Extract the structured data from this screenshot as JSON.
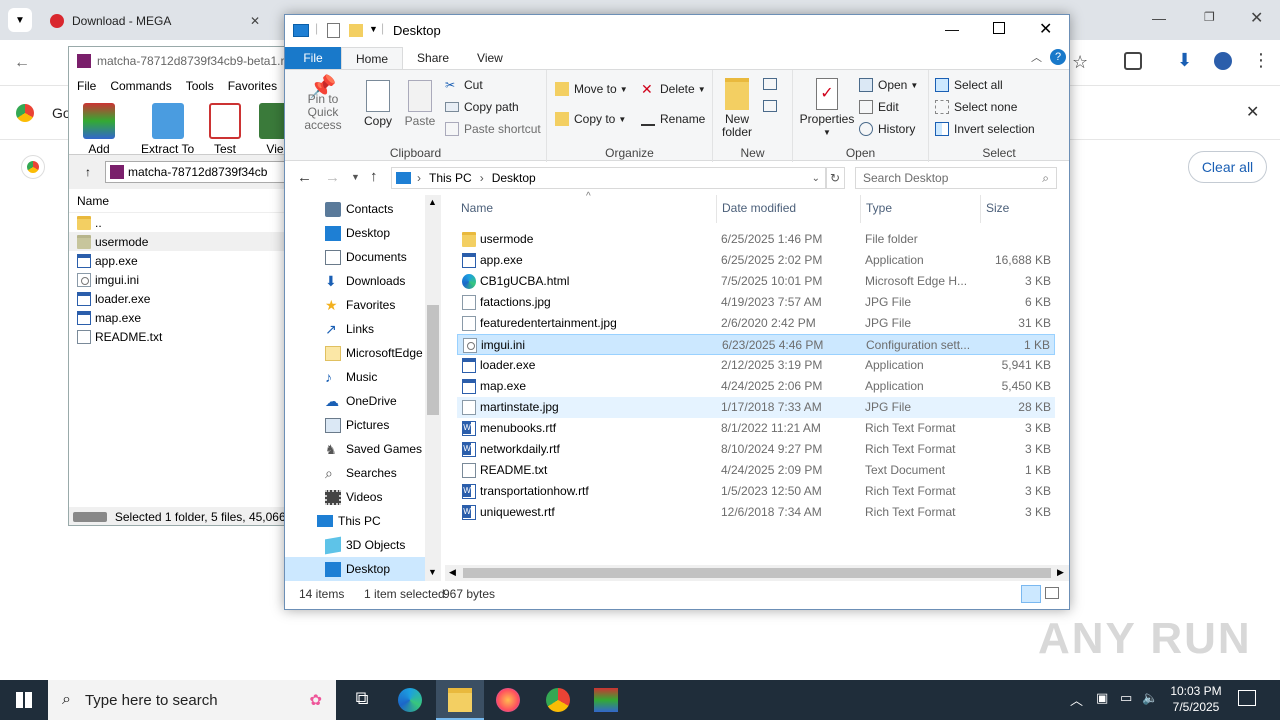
{
  "chrome": {
    "tab1_title": "Download - MEGA",
    "notice_prefix": "Go",
    "clear_all": "Clear all"
  },
  "winrar": {
    "title": "matcha-78712d8739f34cb9-beta1.r",
    "menu": [
      "File",
      "Commands",
      "Tools",
      "Favorites"
    ],
    "toolbar": [
      "Add",
      "Extract To",
      "Test",
      "Vie"
    ],
    "path": "matcha-78712d8739f34cb",
    "column_name": "Name",
    "rows": [
      "..",
      "usermode",
      "app.exe",
      "imgui.ini",
      "loader.exe",
      "map.exe",
      "README.txt"
    ],
    "status": "Selected 1 folder, 5 files, 45,066,"
  },
  "explorer": {
    "title": "Desktop",
    "tabs": [
      "File",
      "Home",
      "Share",
      "View"
    ],
    "clipboard": {
      "pin": "Pin to Quick access",
      "copy": "Copy",
      "paste": "Paste",
      "cut": "Cut",
      "copy_path": "Copy path",
      "paste_shortcut": "Paste shortcut",
      "label": "Clipboard"
    },
    "organize": {
      "move_to": "Move to",
      "copy_to": "Copy to",
      "delete": "Delete",
      "rename": "Rename",
      "label": "Organize"
    },
    "new": {
      "new_folder": "New folder",
      "label": "New"
    },
    "open": {
      "properties": "Properties",
      "open": "Open",
      "edit": "Edit",
      "history": "History",
      "label": "Open"
    },
    "select": {
      "select_all": "Select all",
      "select_none": "Select none",
      "invert": "Invert selection",
      "label": "Select"
    },
    "breadcrumb": [
      "This PC",
      "Desktop"
    ],
    "search_placeholder": "Search Desktop",
    "nav": [
      {
        "label": "Contacts",
        "icon": "contacts-icon"
      },
      {
        "label": "Desktop",
        "icon": "desktop-icon"
      },
      {
        "label": "Documents",
        "icon": "documents-icon"
      },
      {
        "label": "Downloads",
        "icon": "downloads-icon"
      },
      {
        "label": "Favorites",
        "icon": "star-icon"
      },
      {
        "label": "Links",
        "icon": "links-icon"
      },
      {
        "label": "MicrosoftEdge",
        "icon": "folder-icon"
      },
      {
        "label": "Music",
        "icon": "music-icon"
      },
      {
        "label": "OneDrive",
        "icon": "onedrive-icon"
      },
      {
        "label": "Pictures",
        "icon": "pictures-icon"
      },
      {
        "label": "Saved Games",
        "icon": "saved-games-icon"
      },
      {
        "label": "Searches",
        "icon": "search-icon"
      },
      {
        "label": "Videos",
        "icon": "videos-icon"
      },
      {
        "label": "This PC",
        "icon": "pc-icon"
      },
      {
        "label": "3D Objects",
        "icon": "3d-objects-icon"
      },
      {
        "label": "Desktop",
        "icon": "desktop-icon"
      }
    ],
    "columns": {
      "name": "Name",
      "date": "Date modified",
      "type": "Type",
      "size": "Size"
    },
    "files": [
      {
        "name": "usermode",
        "date": "6/25/2025 1:46 PM",
        "type": "File folder",
        "size": "",
        "icon": "folder"
      },
      {
        "name": "app.exe",
        "date": "6/25/2025 2:02 PM",
        "type": "Application",
        "size": "16,688 KB",
        "icon": "exe"
      },
      {
        "name": "CB1gUCBA.html",
        "date": "7/5/2025 10:01 PM",
        "type": "Microsoft Edge H...",
        "size": "3 KB",
        "icon": "edge"
      },
      {
        "name": "fatactions.jpg",
        "date": "4/19/2023 7:57 AM",
        "type": "JPG File",
        "size": "6 KB",
        "icon": "jpg"
      },
      {
        "name": "featuredentertainment.jpg",
        "date": "2/6/2020 2:42 PM",
        "type": "JPG File",
        "size": "31 KB",
        "icon": "jpg"
      },
      {
        "name": "imgui.ini",
        "date": "6/23/2025 4:46 PM",
        "type": "Configuration sett...",
        "size": "1 KB",
        "icon": "ini"
      },
      {
        "name": "loader.exe",
        "date": "2/12/2025 3:19 PM",
        "type": "Application",
        "size": "5,941 KB",
        "icon": "exe"
      },
      {
        "name": "map.exe",
        "date": "4/24/2025 2:06 PM",
        "type": "Application",
        "size": "5,450 KB",
        "icon": "exe"
      },
      {
        "name": "martinstate.jpg",
        "date": "1/17/2018 7:33 AM",
        "type": "JPG File",
        "size": "28 KB",
        "icon": "jpg"
      },
      {
        "name": "menubooks.rtf",
        "date": "8/1/2022 11:21 AM",
        "type": "Rich Text Format",
        "size": "3 KB",
        "icon": "rtf"
      },
      {
        "name": "networkdaily.rtf",
        "date": "8/10/2024 9:27 PM",
        "type": "Rich Text Format",
        "size": "3 KB",
        "icon": "rtf"
      },
      {
        "name": "README.txt",
        "date": "4/24/2025 2:09 PM",
        "type": "Text Document",
        "size": "1 KB",
        "icon": "txt"
      },
      {
        "name": "transportationhow.rtf",
        "date": "1/5/2023 12:50 AM",
        "type": "Rich Text Format",
        "size": "3 KB",
        "icon": "rtf"
      },
      {
        "name": "uniquewest.rtf",
        "date": "12/6/2018 7:34 AM",
        "type": "Rich Text Format",
        "size": "3 KB",
        "icon": "rtf"
      }
    ],
    "status": {
      "items": "14 items",
      "selected": "1 item selected",
      "bytes": "967 bytes"
    }
  },
  "taskbar": {
    "search_placeholder": "Type here to search",
    "time": "10:03 PM",
    "date": "7/5/2025"
  },
  "watermark": "ANY RUN"
}
